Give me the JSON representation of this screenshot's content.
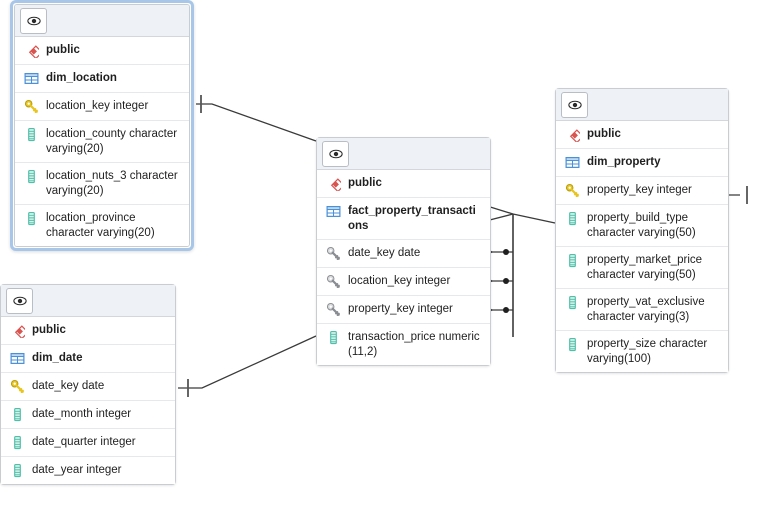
{
  "diagram": {
    "kind": "database-er-diagram",
    "background": "#ffffff",
    "colors": {
      "selection_border": "#a8c7e8",
      "entity_border": "#c9ccd1",
      "header_background": "#eef1f5",
      "schema_icon": "#d9534f",
      "table_icon": "#4a90d9",
      "primary_key_icon": "#e8c51e",
      "foreign_key_icon": "#8a8d91",
      "column_icon": "#4fbfa8",
      "edge_line": "#3a3a3a"
    }
  },
  "entities": [
    {
      "id": "dim_location",
      "selected": true,
      "eye_icon": "eye-icon",
      "schema": "public",
      "table": "dim_location",
      "columns": [
        {
          "name": "location_key integer",
          "icon": "primary-key-icon"
        },
        {
          "name": "location_county character varying(20)",
          "icon": "column-icon"
        },
        {
          "name": "location_nuts_3 character varying(20)",
          "icon": "column-icon"
        },
        {
          "name": "location_province character varying(20)",
          "icon": "column-icon"
        }
      ]
    },
    {
      "id": "fact_property_transactions",
      "selected": false,
      "eye_icon": "eye-icon",
      "schema": "public",
      "table": "fact_property_transactions",
      "columns": [
        {
          "name": "date_key date",
          "icon": "foreign-key-icon"
        },
        {
          "name": "location_key integer",
          "icon": "foreign-key-icon"
        },
        {
          "name": "property_key integer",
          "icon": "foreign-key-icon"
        },
        {
          "name": "transaction_price numeric (11,2)",
          "icon": "column-icon"
        }
      ]
    },
    {
      "id": "dim_property",
      "selected": false,
      "eye_icon": "eye-icon",
      "schema": "public",
      "table": "dim_property",
      "columns": [
        {
          "name": "property_key integer",
          "icon": "primary-key-icon"
        },
        {
          "name": "property_build_type character varying(50)",
          "icon": "column-icon"
        },
        {
          "name": "property_market_price character varying(50)",
          "icon": "column-icon"
        },
        {
          "name": "property_vat_exclusive character varying(3)",
          "icon": "column-icon"
        },
        {
          "name": "property_size character varying(100)",
          "icon": "column-icon"
        }
      ]
    },
    {
      "id": "dim_date",
      "selected": false,
      "eye_icon": "eye-icon",
      "schema": "public",
      "table": "dim_date",
      "columns": [
        {
          "name": "date_key date",
          "icon": "primary-key-icon"
        },
        {
          "name": "date_month integer",
          "icon": "column-icon"
        },
        {
          "name": "date_quarter integer",
          "icon": "column-icon"
        },
        {
          "name": "date_year integer",
          "icon": "column-icon"
        }
      ]
    }
  ],
  "relationships": [
    {
      "from": "dim_location.location_key",
      "to": "fact_property_transactions.location_key",
      "from_cardinality": "one",
      "to_cardinality": "many"
    },
    {
      "from": "dim_date.date_key",
      "to": "fact_property_transactions.date_key",
      "from_cardinality": "one",
      "to_cardinality": "many"
    },
    {
      "from": "dim_property.property_key",
      "to": "fact_property_transactions.property_key",
      "from_cardinality": "one",
      "to_cardinality": "many"
    }
  ]
}
